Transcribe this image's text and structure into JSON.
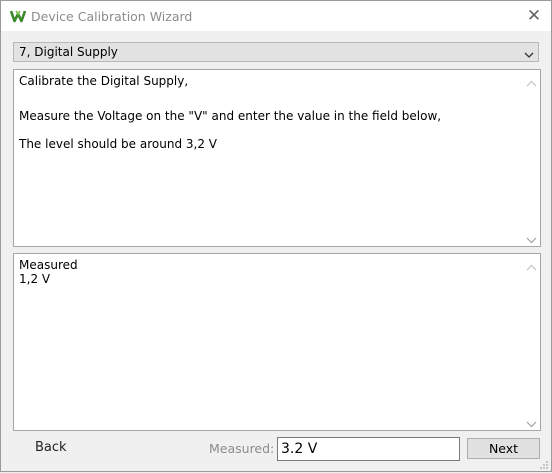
{
  "window": {
    "title": "Device Calibration Wizard"
  },
  "step_dropdown": {
    "selected": "7, Digital Supply"
  },
  "instructions": {
    "line1": "Calibrate the Digital Supply,",
    "line2": "Measure the Voltage on the \"V\" and enter the value in the field below,",
    "line3": "The level should be around 3,2 V"
  },
  "measurements_log": {
    "line1": "Measured",
    "line2": "1,2 V"
  },
  "footer": {
    "back_label": "Back",
    "measured_label": "Measured:",
    "measured_value": "3.2 V",
    "next_label": "Next"
  },
  "colors": {
    "app_icon_green": "#3a8a2a",
    "title_gray": "#8c8c8c",
    "dialog_bg": "#f0f0f0"
  },
  "icons": {
    "app": "app-logo-icon",
    "close": "close-icon",
    "dropdown": "chevron-down-icon"
  }
}
